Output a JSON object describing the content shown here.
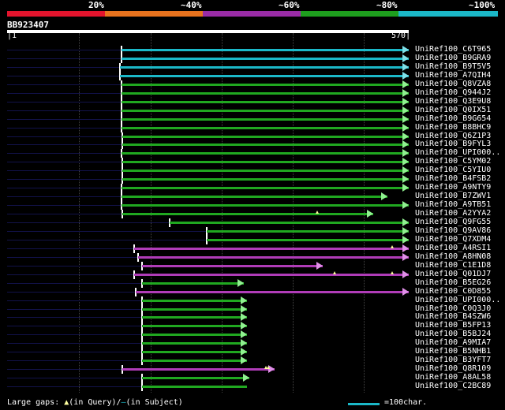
{
  "scale": {
    "labels": [
      "20%",
      "~40%",
      "~60%",
      "~80%",
      "~100%"
    ],
    "colors": [
      "#e3142d",
      "#e8731e",
      "#9a2ca6",
      "#1e9e1e",
      "#1bb8c8"
    ]
  },
  "query": {
    "id": "BB923407",
    "start": "1",
    "end": "570",
    "length": 570
  },
  "colors": {
    "cyan": "#1bb8c8",
    "green": "#20a820",
    "magenta": "#b03cb8",
    "arrow_cyan": "#7fe0e8",
    "arrow_green": "#90f090",
    "arrow_magenta": "#e090e8"
  },
  "hits": [
    {
      "acc": "UniRef100_C6T965",
      "color": "cyan",
      "start": 162,
      "end": 570,
      "arrow": true
    },
    {
      "acc": "UniRef100_B9GRA9",
      "color": "cyan",
      "start": 162,
      "end": 570,
      "arrow": true
    },
    {
      "acc": "UniRef100_B9T5V5",
      "color": "cyan",
      "start": 160,
      "end": 570,
      "arrow": true
    },
    {
      "acc": "UniRef100_A7QIH4",
      "color": "cyan",
      "start": 160,
      "end": 570,
      "arrow": true
    },
    {
      "acc": "UniRef100_Q8VZA8",
      "color": "green",
      "start": 162,
      "end": 570,
      "arrow": true
    },
    {
      "acc": "UniRef100_Q944J2",
      "color": "green",
      "start": 162,
      "end": 570,
      "arrow": true
    },
    {
      "acc": "UniRef100_Q3E9U8",
      "color": "green",
      "start": 162,
      "end": 570,
      "arrow": true
    },
    {
      "acc": "UniRef100_Q0IX51",
      "color": "green",
      "start": 162,
      "end": 570,
      "arrow": true
    },
    {
      "acc": "UniRef100_B9G654",
      "color": "green",
      "start": 162,
      "end": 570,
      "arrow": true
    },
    {
      "acc": "UniRef100_B8BHC9",
      "color": "green",
      "start": 162,
      "end": 570,
      "arrow": true
    },
    {
      "acc": "UniRef100_Q6Z1P3",
      "color": "green",
      "start": 163,
      "end": 570,
      "arrow": true
    },
    {
      "acc": "UniRef100_B9FYL3",
      "color": "green",
      "start": 163,
      "end": 570,
      "arrow": true
    },
    {
      "acc": "UniRef100_UPI000..",
      "color": "green",
      "start": 162,
      "end": 570,
      "arrow": true
    },
    {
      "acc": "UniRef100_C5YM02",
      "color": "green",
      "start": 163,
      "end": 570,
      "arrow": true
    },
    {
      "acc": "UniRef100_C5YIU0",
      "color": "green",
      "start": 163,
      "end": 570,
      "arrow": true
    },
    {
      "acc": "UniRef100_B4FSB2",
      "color": "green",
      "start": 163,
      "end": 570,
      "arrow": true
    },
    {
      "acc": "UniRef100_A9NTY9",
      "color": "green",
      "start": 162,
      "end": 570,
      "arrow": true
    },
    {
      "acc": "UniRef100_B7ZWV1",
      "color": "green",
      "start": 162,
      "end": 540,
      "arrow": true
    },
    {
      "acc": "UniRef100_A9TB51",
      "color": "green",
      "start": 162,
      "end": 570,
      "arrow": true
    },
    {
      "acc": "UniRef100_A2YYA2",
      "color": "green",
      "start": 164,
      "end": 520,
      "arrow": true,
      "gaps": [
        440
      ]
    },
    {
      "acc": "UniRef100_Q9FG55",
      "color": "green",
      "start": 231,
      "end": 570,
      "arrow": true
    },
    {
      "acc": "UniRef100_Q9AV86",
      "color": "green",
      "start": 283,
      "end": 570,
      "arrow": true
    },
    {
      "acc": "UniRef100_Q7XDM4",
      "color": "green",
      "start": 283,
      "end": 570,
      "arrow": true
    },
    {
      "acc": "UniRef100_A4RSI1",
      "color": "magenta",
      "start": 180,
      "end": 570,
      "arrow": true,
      "gaps": [
        546
      ]
    },
    {
      "acc": "UniRef100_A8HN08",
      "color": "magenta",
      "start": 186,
      "end": 570,
      "arrow": true
    },
    {
      "acc": "UniRef100_C1E1D8",
      "color": "magenta",
      "start": 191,
      "end": 448,
      "arrow": true
    },
    {
      "acc": "UniRef100_Q01DJ7",
      "color": "magenta",
      "start": 180,
      "end": 570,
      "arrow": true,
      "gaps": [
        465,
        546
      ]
    },
    {
      "acc": "UniRef100_B5EG26",
      "color": "green",
      "start": 191,
      "end": 336,
      "arrow": true
    },
    {
      "acc": "UniRef100_C0D855",
      "color": "magenta",
      "start": 183,
      "end": 570,
      "arrow": true
    },
    {
      "acc": "UniRef100_UPI000..",
      "color": "green",
      "start": 191,
      "end": 340,
      "arrow": true
    },
    {
      "acc": "UniRef100_C0Q3J0",
      "color": "green",
      "start": 191,
      "end": 340,
      "arrow": true
    },
    {
      "acc": "UniRef100_B4SZW6",
      "color": "green",
      "start": 191,
      "end": 340,
      "arrow": true
    },
    {
      "acc": "UniRef100_B5FP13",
      "color": "green",
      "start": 191,
      "end": 340,
      "arrow": true
    },
    {
      "acc": "UniRef100_B5BJ24",
      "color": "green",
      "start": 191,
      "end": 340,
      "arrow": true
    },
    {
      "acc": "UniRef100_A9MIA7",
      "color": "green",
      "start": 191,
      "end": 340,
      "arrow": true
    },
    {
      "acc": "UniRef100_B5NHB1",
      "color": "green",
      "start": 191,
      "end": 340,
      "arrow": true
    },
    {
      "acc": "UniRef100_B3YFT7",
      "color": "green",
      "start": 191,
      "end": 340,
      "arrow": true
    },
    {
      "acc": "UniRef100_Q8R109",
      "color": "magenta",
      "start": 164,
      "end": 380,
      "arrow": true,
      "gaps": [
        367,
        371
      ]
    },
    {
      "acc": "UniRef100_A8AL58",
      "color": "green",
      "start": 191,
      "end": 344,
      "arrow": true
    },
    {
      "acc": "UniRef100_C2BC89",
      "color": "green",
      "start": 191,
      "end": 340,
      "arrow": false
    }
  ],
  "footer": {
    "gaps_prefix": "Large gaps: ",
    "gaps_query": "(in Query)/",
    "gaps_subject": "(in Subject)",
    "legend_scale": "=100char."
  }
}
